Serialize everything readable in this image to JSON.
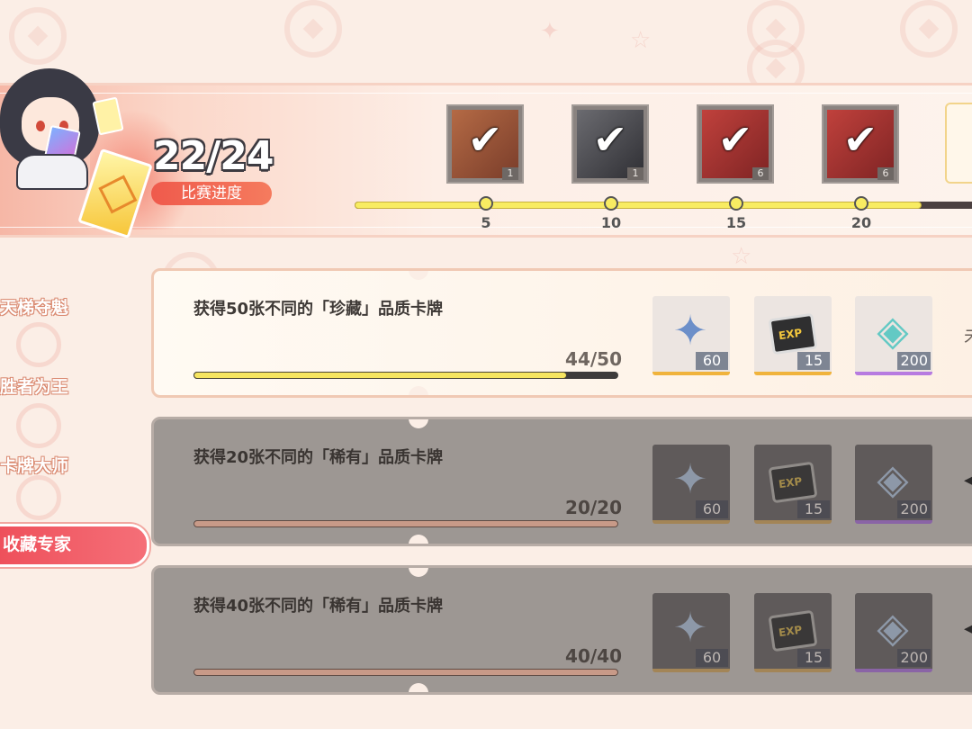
{
  "header": {
    "progress_count": "22/24",
    "progress_label": "比赛进度",
    "progress_fraction": 0.9,
    "milestones": [
      {
        "threshold": "5",
        "qty": "1",
        "claimed": true,
        "art": "book"
      },
      {
        "threshold": "10",
        "qty": "1",
        "claimed": true,
        "art": "figure"
      },
      {
        "threshold": "15",
        "qty": "6",
        "claimed": true,
        "art": "box"
      },
      {
        "threshold": "20",
        "qty": "6",
        "claimed": true,
        "art": "box"
      }
    ]
  },
  "sidebar": {
    "items": [
      {
        "label": "天梯夺魁",
        "active": false
      },
      {
        "label": "胜者为王",
        "active": false
      },
      {
        "label": "卡牌大师",
        "active": false
      },
      {
        "label": "收藏专家",
        "active": true
      }
    ]
  },
  "missions": [
    {
      "title": "获得50张不同的「珍藏」品质卡牌",
      "count": "44/50",
      "progress": 0.88,
      "state": "open",
      "status_text": "未",
      "rewards": [
        {
          "icon": "star-crystal-icon",
          "qty": "60",
          "rarity": "legend"
        },
        {
          "icon": "exp-chip-icon",
          "qty": "15",
          "rarity": "legend"
        },
        {
          "icon": "gem-orb-icon",
          "qty": "200",
          "rarity": "epic"
        }
      ]
    },
    {
      "title": "获得20张不同的「稀有」品质卡牌",
      "count": "20/20",
      "progress": 1.0,
      "state": "done",
      "rewards": [
        {
          "icon": "star-crystal-icon",
          "qty": "60",
          "rarity": "legend"
        },
        {
          "icon": "exp-chip-icon",
          "qty": "15",
          "rarity": "legend"
        },
        {
          "icon": "gem-orb-icon",
          "qty": "200",
          "rarity": "epic"
        }
      ]
    },
    {
      "title": "获得40张不同的「稀有」品质卡牌",
      "count": "40/40",
      "progress": 1.0,
      "state": "done",
      "rewards": [
        {
          "icon": "star-crystal-icon",
          "qty": "60",
          "rarity": "legend"
        },
        {
          "icon": "exp-chip-icon",
          "qty": "15",
          "rarity": "legend"
        },
        {
          "icon": "gem-orb-icon",
          "qty": "200",
          "rarity": "epic"
        }
      ]
    }
  ],
  "colors": {
    "accent_red": "#ee4f5a",
    "progress_yellow": "#f8ec62",
    "background": "#fbeee6"
  }
}
